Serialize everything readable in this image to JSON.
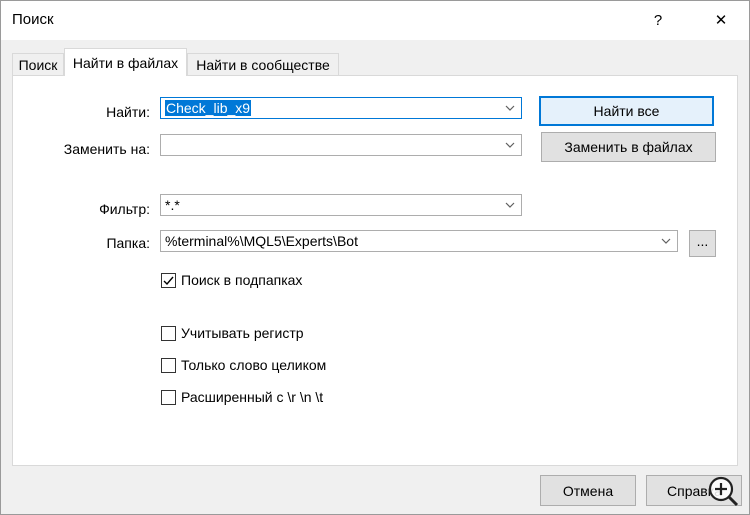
{
  "window": {
    "title": "Поиск",
    "help": "?",
    "close": "✕"
  },
  "tabs": [
    {
      "label": "Поиск"
    },
    {
      "label": "Найти в файлах"
    },
    {
      "label": "Найти в сообществе"
    }
  ],
  "form": {
    "find_label": "Найти:",
    "find_value": "Check_lib_x9",
    "replace_label": "Заменить на:",
    "replace_value": "",
    "filter_label": "Фильтр:",
    "filter_value": "*.*",
    "folder_label": "Папка:",
    "folder_value": "%terminal%\\MQL5\\Experts\\Bot",
    "browse_label": "...",
    "find_all_label": "Найти все",
    "replace_in_files_label": "Заменить в файлах"
  },
  "options": {
    "subfolders": {
      "label": "Поиск в подпапках",
      "checked": true
    },
    "match_case": {
      "label": "Учитывать регистр",
      "checked": false
    },
    "whole_word": {
      "label": "Только слово целиком",
      "checked": false
    },
    "extended": {
      "label": "Расширенный с \\r \\n \\t",
      "checked": false
    }
  },
  "footer": {
    "cancel_label": "Отмена",
    "help_label": "Справка"
  },
  "colors": {
    "accent": "#0078d7",
    "panel_bg": "#ffffff",
    "window_bg": "#f0f0f0"
  }
}
